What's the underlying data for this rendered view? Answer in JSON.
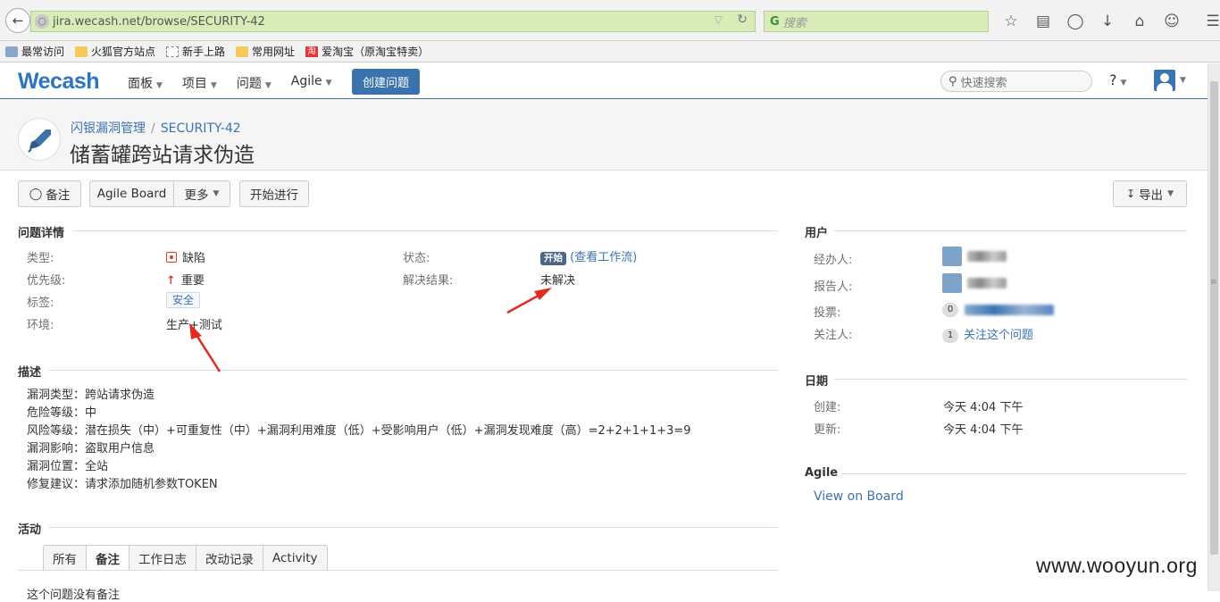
{
  "browser": {
    "url": "jira.wecash.net/browse/SECURITY-42",
    "search_placeholder": "搜索",
    "bookmarks": [
      "最常访问",
      "火狐官方站点",
      "新手上路",
      "常用网址",
      "爱淘宝（原淘宝特卖）"
    ],
    "taobao_icon_text": "淘"
  },
  "header": {
    "logo": "Wecash",
    "nav": [
      "面板",
      "项目",
      "问题",
      "Agile"
    ],
    "create_label": "创建问题",
    "quick_search_placeholder": "快速搜索",
    "help_icon": "?"
  },
  "issue": {
    "breadcrumb_project": "闪银漏洞管理",
    "breadcrumb_key": "SECURITY-42",
    "summary": "储蓄罐跨站请求伪造"
  },
  "toolbar": {
    "comment": "备注",
    "agile_board": "Agile Board",
    "more": "更多",
    "start_progress": "开始进行",
    "export": "导出"
  },
  "details": {
    "title": "问题详情",
    "type_label": "类型:",
    "type_value": "缺陷",
    "priority_label": "优先级:",
    "priority_value": "重要",
    "labels_label": "标签:",
    "labels_value": "安全",
    "env_label": "环境:",
    "env_value": "生产+测试",
    "status_label": "状态:",
    "status_value": "开始",
    "workflow_link": "(查看工作流)",
    "resolution_label": "解决结果:",
    "resolution_value": "未解决"
  },
  "description": {
    "title": "描述",
    "lines": [
      "漏洞类型：跨站请求伪造",
      "危险等级：中",
      "风险等级：潜在损失（中）+可重复性（中）+漏洞利用难度（低）+受影响用户（低）+漏洞发现难度（高）=2+2+1+1+3=9",
      "漏洞影响：盗取用户信息",
      "漏洞位置：全站",
      "修复建议：请求添加随机参数TOKEN"
    ]
  },
  "activity": {
    "title": "活动",
    "tabs": [
      "所有",
      "备注",
      "工作日志",
      "改动记录",
      "Activity"
    ],
    "empty_text": "这个问题没有备注"
  },
  "people": {
    "title": "用户",
    "assignee_label": "经办人:",
    "reporter_label": "报告人:",
    "votes_label": "投票:",
    "votes_count": "0",
    "watchers_label": "关注人:",
    "watchers_count": "1",
    "watch_link": "关注这个问题"
  },
  "dates": {
    "title": "日期",
    "created_label": "创建:",
    "created_value": "今天 4:04 下午",
    "updated_label": "更新:",
    "updated_value": "今天 4:04 下午"
  },
  "agile": {
    "title": "Agile",
    "view_on_board": "View on Board"
  },
  "watermark": "www.wooyun.org"
}
